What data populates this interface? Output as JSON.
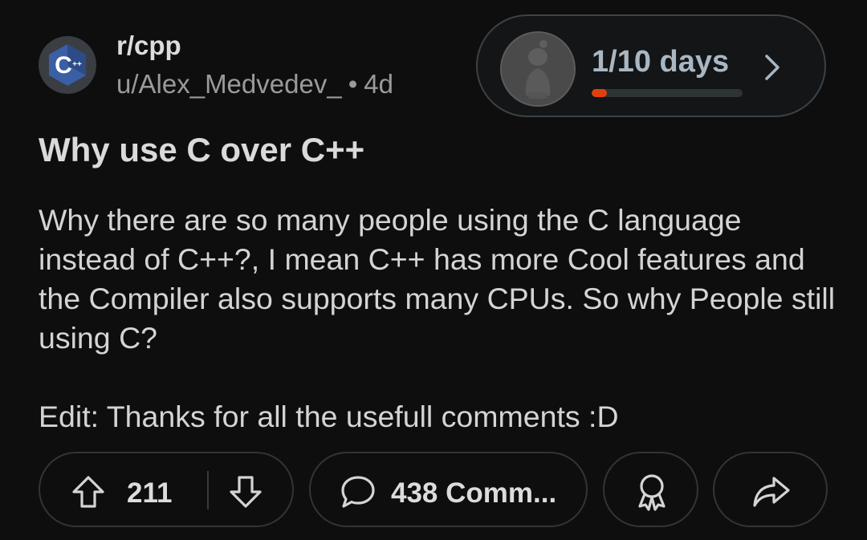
{
  "post": {
    "subreddit": "r/cpp",
    "author": "u/Alex_Medvedev_",
    "separator": "•",
    "age": "4d",
    "title": "Why use C over C++",
    "body": [
      "Why there are so many people using the C language instead of C++?, I mean C++ has more Cool features and the Compiler also supports many CPUs. So why People still using C?",
      "Edit: Thanks for all the usefull comments :D"
    ]
  },
  "subreddit_icon": {
    "text": "C",
    "badge": "++",
    "color": "#3b5fa5"
  },
  "streak": {
    "label": "1/10 days",
    "progress": 0.1,
    "progress_color": "#e0400f"
  },
  "actions": {
    "upvotes": "211",
    "comments": "438 Comm...",
    "upvote_icon": "arrow-up-icon",
    "downvote_icon": "arrow-down-icon",
    "comment_icon": "speech-bubble-icon",
    "award_icon": "award-ribbon-icon",
    "share_icon": "share-arrow-icon"
  }
}
